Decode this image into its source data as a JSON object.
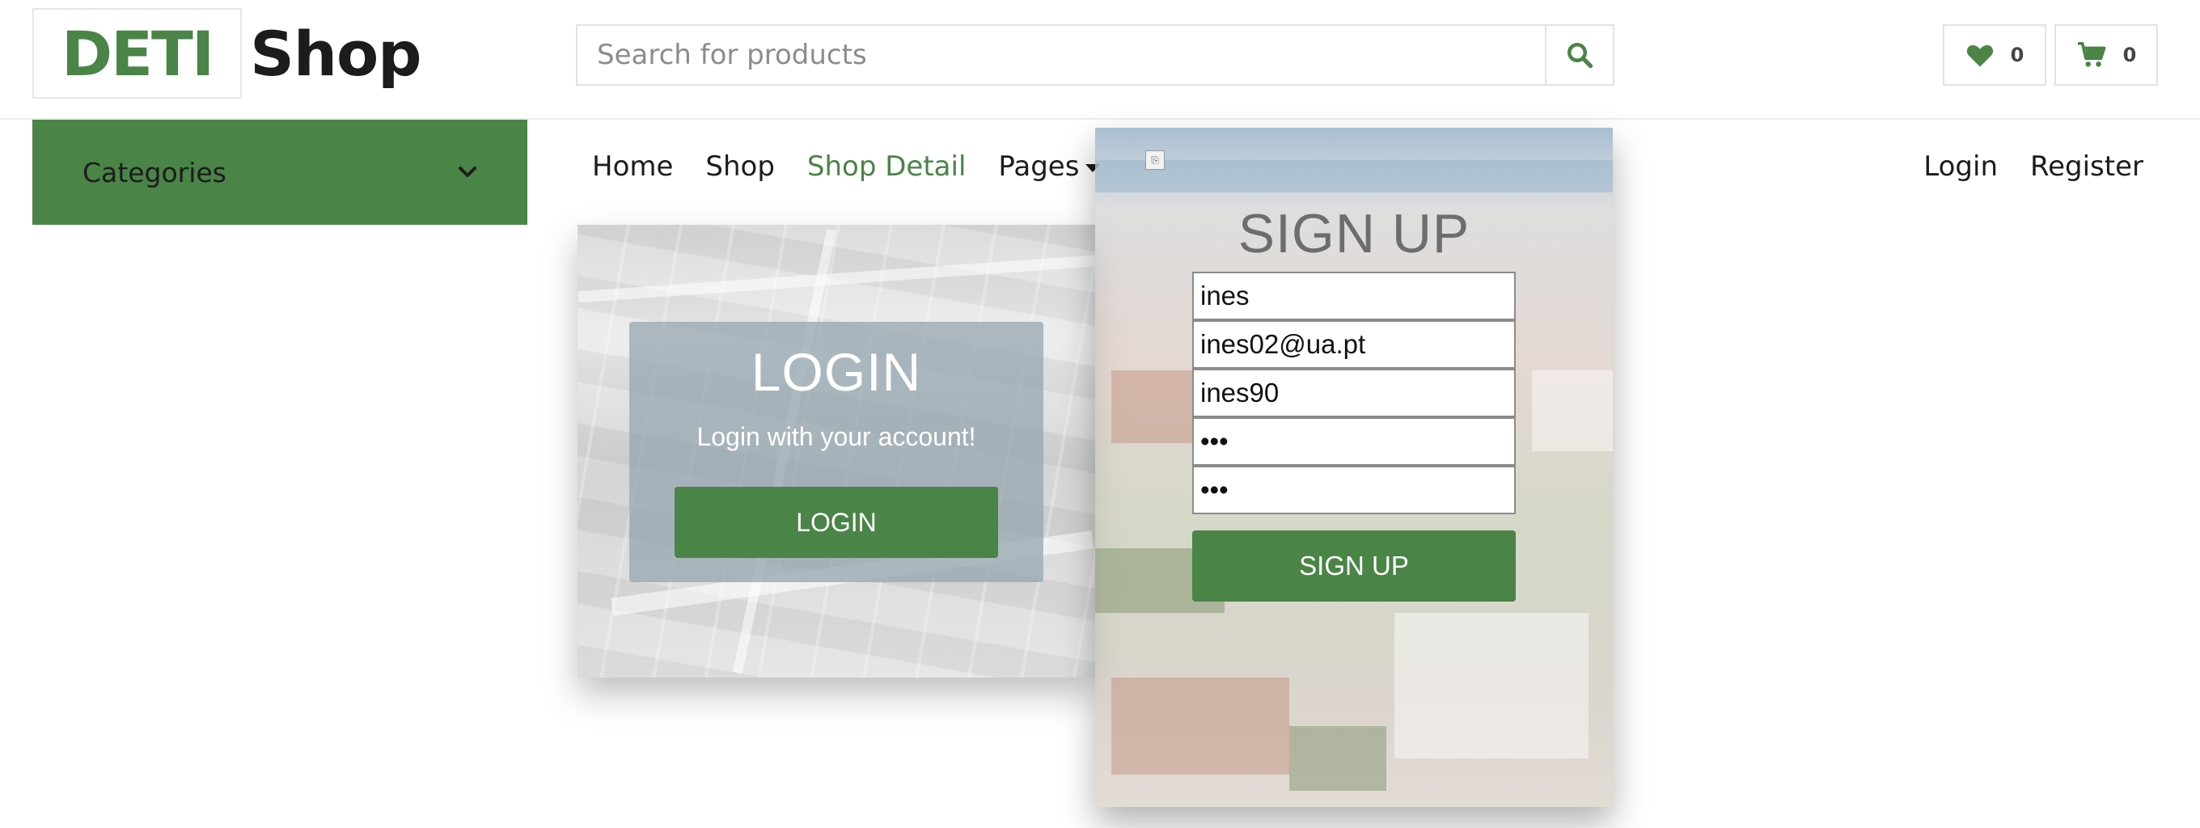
{
  "brand": {
    "part1": "DETI",
    "part2": "Shop",
    "accent": "#4a8447"
  },
  "search": {
    "placeholder": "Search for products",
    "value": "",
    "icon": "search-icon"
  },
  "header_counters": {
    "wishlist": {
      "icon": "heart-icon",
      "count": "0"
    },
    "cart": {
      "icon": "shopping-cart-icon",
      "count": "0"
    }
  },
  "categories": {
    "label": "Categories",
    "icon": "chevron-down-icon"
  },
  "nav": {
    "items": [
      {
        "label": "Home"
      },
      {
        "label": "Shop"
      },
      {
        "label": "Shop Detail",
        "active": true
      },
      {
        "label": "Pages"
      }
    ],
    "right": [
      {
        "label": "Login"
      },
      {
        "label": "Register"
      }
    ]
  },
  "login_panel": {
    "title": "LOGIN",
    "subtitle": "Login with your account!",
    "button": "LOGIN"
  },
  "signup_panel": {
    "title": "SIGN UP",
    "fields": [
      {
        "name": "username",
        "value": "ines"
      },
      {
        "name": "email",
        "value": "ines02@ua.pt"
      },
      {
        "name": "nickname",
        "value": "ines90"
      },
      {
        "name": "password",
        "value": "•••"
      },
      {
        "name": "confirm_password",
        "value": "•••"
      }
    ],
    "button": "SIGN UP"
  }
}
